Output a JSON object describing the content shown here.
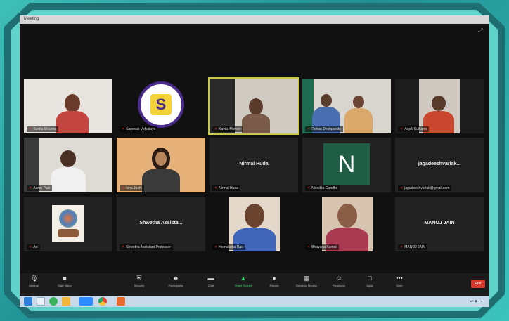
{
  "window": {
    "title": "Meeting"
  },
  "participants": [
    {
      "name": "Sunita Sharma",
      "type": "video"
    },
    {
      "name": "Sarswati Vidyalaya",
      "type": "logo"
    },
    {
      "name": "Kavita Menon",
      "type": "video",
      "active": true
    },
    {
      "name": "Rohan Deshpande",
      "type": "video"
    },
    {
      "name": "Anjali Kulkarni",
      "type": "video"
    },
    {
      "name": "Aarav Patil",
      "type": "video"
    },
    {
      "name": "Isha Joshi",
      "type": "video"
    },
    {
      "name": "Nirmal Huda",
      "type": "name-only",
      "display": "Nirmal Huda"
    },
    {
      "name": "Nivedita Gandhe",
      "type": "letter",
      "letter": "N"
    },
    {
      "name": "jagadeeshvarlak@gmail.com",
      "type": "name-only",
      "display": "jagadeeshvarlak..."
    },
    {
      "name": "Art",
      "type": "image"
    },
    {
      "name": "Shwetha Assistant Professor",
      "type": "name-only",
      "display": "Shwetha Assista..."
    },
    {
      "name": "Hemalatha Rao",
      "type": "video"
    },
    {
      "name": "Bhavana Kamat",
      "type": "video"
    },
    {
      "name": "MANOJ JAIN",
      "type": "name-only",
      "display": "MANOJ JAIN"
    }
  ],
  "toolbar": {
    "items": [
      {
        "label": "Unmute",
        "icon": "mic-icon"
      },
      {
        "label": "Start Video",
        "icon": "video-icon"
      },
      {
        "label": "Security",
        "icon": "shield-icon"
      },
      {
        "label": "Participants",
        "icon": "participants-icon"
      },
      {
        "label": "Chat",
        "icon": "chat-icon"
      },
      {
        "label": "Share Screen",
        "icon": "share-icon"
      },
      {
        "label": "Record",
        "icon": "record-icon"
      },
      {
        "label": "Breakout Rooms",
        "icon": "grid-icon"
      },
      {
        "label": "Reactions",
        "icon": "smile-icon"
      },
      {
        "label": "Apps",
        "icon": "apps-icon"
      },
      {
        "label": "More",
        "icon": "more-icon"
      }
    ],
    "end_label": "End",
    "share_color": "#3ad46a",
    "end_color": "#d63a2e"
  },
  "taskbar": {
    "tray_text": "◂ ▪ ◆ ▪ ◂"
  }
}
